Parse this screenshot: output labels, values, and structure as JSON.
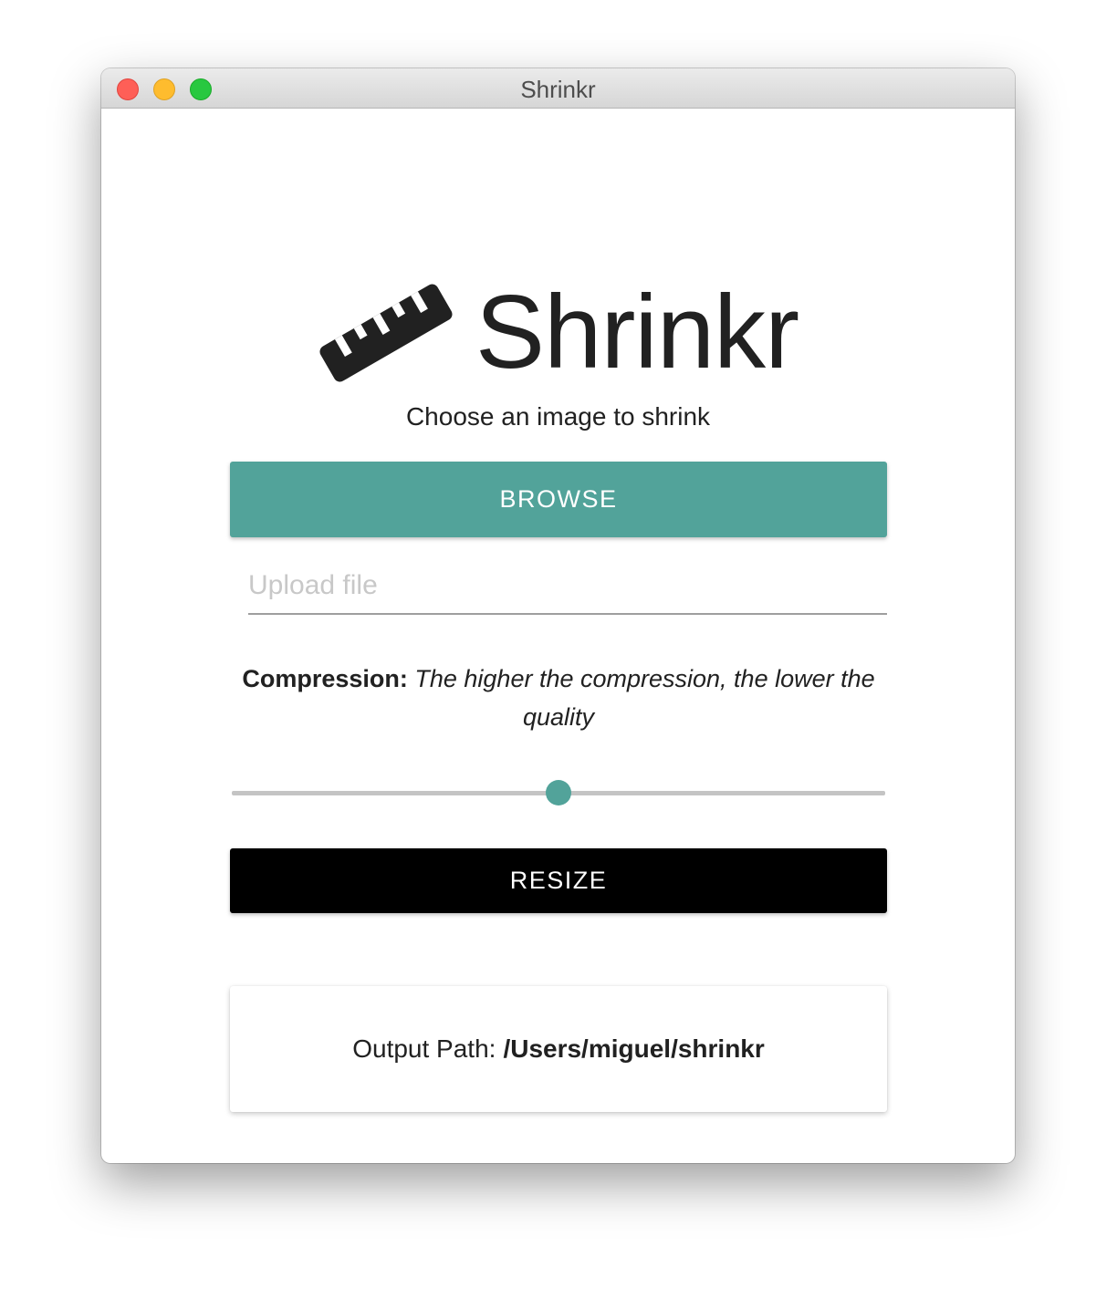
{
  "window": {
    "title": "Shrinkr"
  },
  "header": {
    "app_name": "Shrinkr",
    "logo_icon": "ruler-icon"
  },
  "main": {
    "subtitle": "Choose an image to shrink",
    "browse_label": "BROWSE",
    "upload_placeholder": "Upload file",
    "upload_value": "",
    "compression_label": "Compression:",
    "compression_hint": "The higher the compression, the lower the quality",
    "compression_level_fraction": 0.5,
    "resize_label": "RESIZE"
  },
  "output": {
    "label": "Output Path:",
    "path": "/Users/miguel/shrinkr"
  },
  "colors": {
    "accent": "#52a39a",
    "resize_button": "#000000",
    "text": "#212121",
    "close": "#fe5f57",
    "minimize": "#febc2e",
    "maximize": "#28c840"
  }
}
